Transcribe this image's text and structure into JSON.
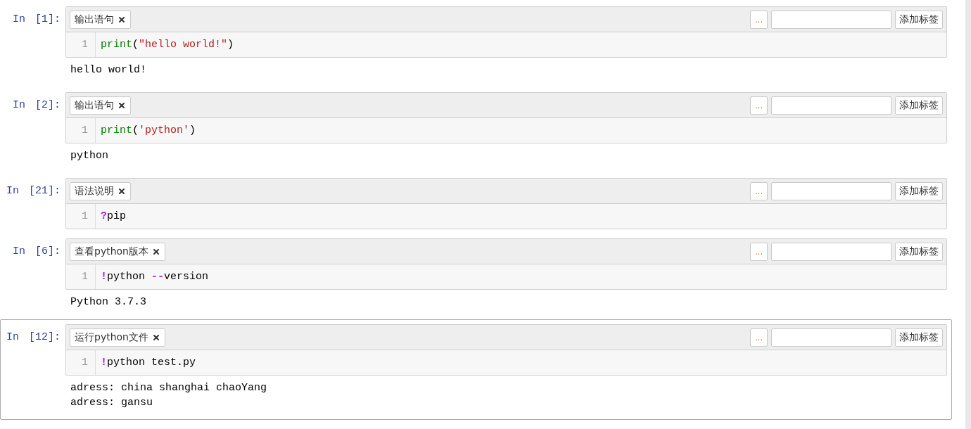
{
  "cells": [
    {
      "prompt": "In",
      "count": "[1]:",
      "selected": false,
      "tags": [
        {
          "label": "输出语句"
        }
      ],
      "tag_menu": "...",
      "add_tag": "添加标签",
      "lines": [
        {
          "number": "1",
          "tokens": [
            {
              "kind": "builtin",
              "text": "print"
            },
            {
              "kind": "plain",
              "text": "("
            },
            {
              "kind": "string",
              "text": "\"hello world!\""
            },
            {
              "kind": "plain",
              "text": ")"
            }
          ]
        }
      ],
      "output": [
        "hello world!"
      ]
    },
    {
      "prompt": "In",
      "count": "[2]:",
      "selected": false,
      "tags": [
        {
          "label": "输出语句"
        }
      ],
      "tag_menu": "...",
      "add_tag": "添加标签",
      "lines": [
        {
          "number": "1",
          "tokens": [
            {
              "kind": "builtin",
              "text": "print"
            },
            {
              "kind": "plain",
              "text": "("
            },
            {
              "kind": "string",
              "text": "'python'"
            },
            {
              "kind": "plain",
              "text": ")"
            }
          ]
        }
      ],
      "output": [
        "python"
      ]
    },
    {
      "prompt": "In",
      "count": "[21]:",
      "selected": false,
      "tags": [
        {
          "label": "语法说明"
        }
      ],
      "tag_menu": "...",
      "add_tag": "添加标签",
      "lines": [
        {
          "number": "1",
          "tokens": [
            {
              "kind": "magic",
              "text": "?"
            },
            {
              "kind": "plain",
              "text": "pip"
            }
          ]
        }
      ]
    },
    {
      "prompt": "In",
      "count": "[6]:",
      "selected": false,
      "tags": [
        {
          "label": "查看python版本"
        }
      ],
      "tag_menu": "...",
      "add_tag": "添加标签",
      "lines": [
        {
          "number": "1",
          "tokens": [
            {
              "kind": "magic",
              "text": "!"
            },
            {
              "kind": "plain",
              "text": "python "
            },
            {
              "kind": "magic",
              "text": "--"
            },
            {
              "kind": "plain",
              "text": "version"
            }
          ]
        }
      ],
      "output": [
        "Python 3.7.3"
      ]
    },
    {
      "prompt": "In",
      "count": "[12]:",
      "selected": true,
      "tags": [
        {
          "label": "运行python文件"
        }
      ],
      "tag_menu": "...",
      "add_tag": "添加标签",
      "lines": [
        {
          "number": "1",
          "tokens": [
            {
              "kind": "magic",
              "text": "!"
            },
            {
              "kind": "plain",
              "text": "python test.py"
            }
          ]
        }
      ],
      "output": [
        "adress: china shanghai chaoYang",
        "adress: gansu"
      ]
    }
  ]
}
